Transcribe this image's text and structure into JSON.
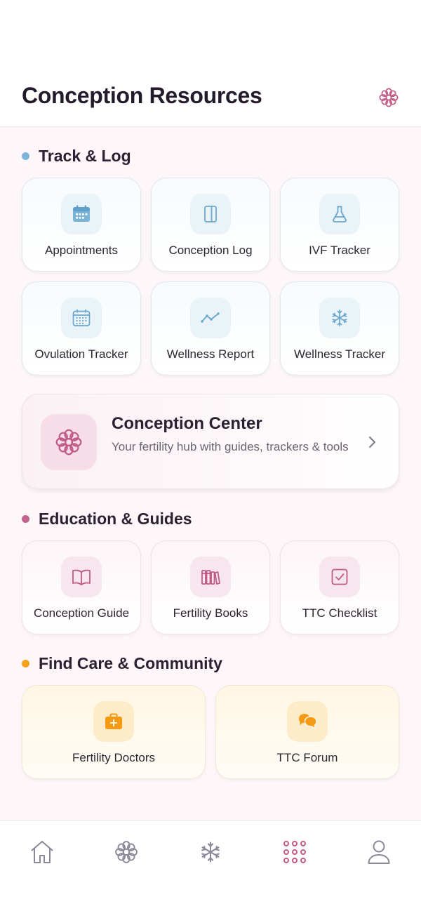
{
  "header": {
    "title": "Conception Resources",
    "icon": "flower-icon"
  },
  "sections": {
    "track": {
      "title": "Track & Log",
      "color": "#7fb5d8",
      "items": [
        {
          "label": "Appointments",
          "icon": "calendar-icon"
        },
        {
          "label": "Conception Log",
          "icon": "notebook-icon"
        },
        {
          "label": "IVF Tracker",
          "icon": "flask-icon"
        },
        {
          "label": "Ovulation Tracker",
          "icon": "calendar-grid-icon"
        },
        {
          "label": "Wellness Report",
          "icon": "trend-line-icon"
        },
        {
          "label": "Wellness Tracker",
          "icon": "snowflake-icon"
        }
      ]
    },
    "center": {
      "title": "Conception Center",
      "subtitle": "Your fertility hub with guides, trackers & tools",
      "icon": "flower-icon"
    },
    "education": {
      "title": "Education & Guides",
      "color": "#c2648d",
      "items": [
        {
          "label": "Conception Guide",
          "icon": "open-book-icon"
        },
        {
          "label": "Fertility Books",
          "icon": "books-icon"
        },
        {
          "label": "TTC Checklist",
          "icon": "checkbox-icon"
        }
      ]
    },
    "care": {
      "title": "Find Care & Community",
      "color": "#f5a11c",
      "items": [
        {
          "label": "Fertility Doctors",
          "icon": "medical-kit-icon"
        },
        {
          "label": "TTC Forum",
          "icon": "chat-bubbles-icon"
        }
      ]
    }
  },
  "nav": [
    {
      "icon": "home-icon"
    },
    {
      "icon": "flower-icon"
    },
    {
      "icon": "snowflake-icon"
    },
    {
      "icon": "apps-grid-icon",
      "active": true
    },
    {
      "icon": "profile-icon"
    }
  ],
  "colors": {
    "blue": "#6aa8cf",
    "pink": "#c05a86",
    "orange": "#f59a12",
    "navGray": "#8c8799"
  }
}
